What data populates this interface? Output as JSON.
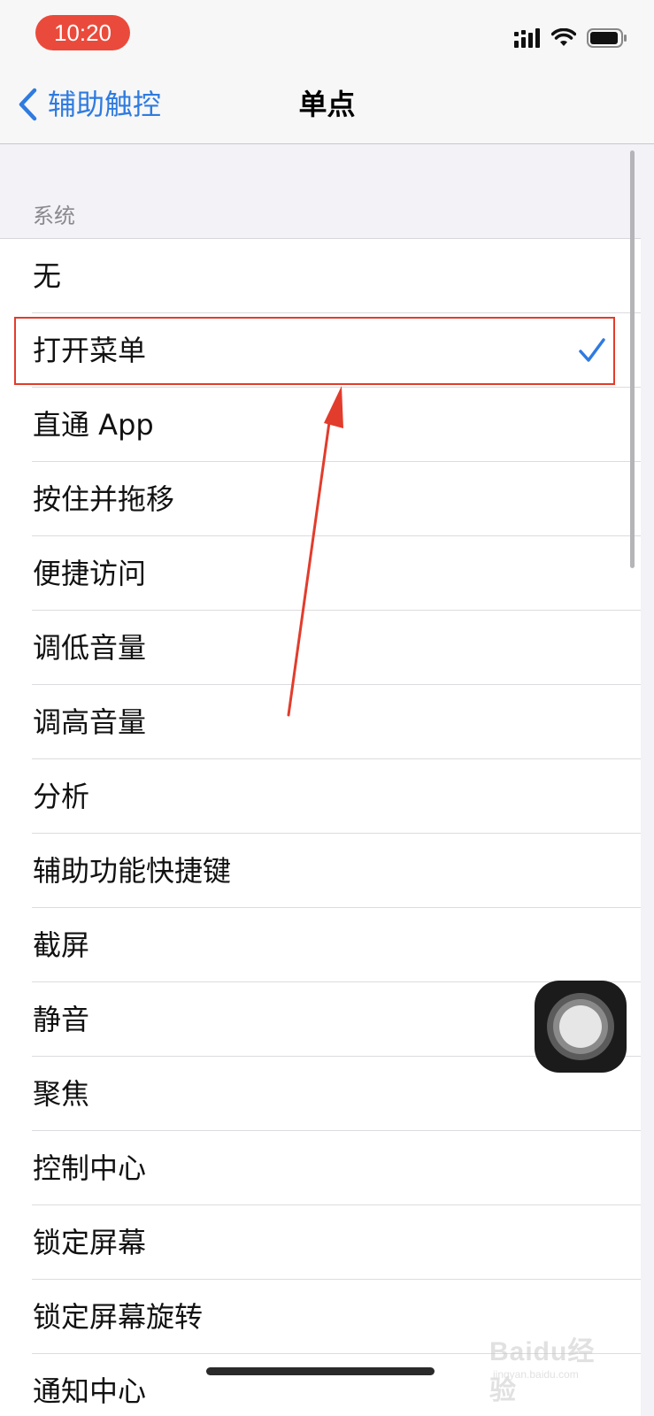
{
  "status_bar": {
    "time": "10:20",
    "icons": [
      "cellular-signal-icon",
      "wifi-icon",
      "battery-icon"
    ],
    "time_pill_color": "#ea4a3b"
  },
  "nav": {
    "back_label": "辅助触控",
    "title": "单点",
    "accent_color": "#2f7be0"
  },
  "section": {
    "header": "系统"
  },
  "list": {
    "selected_index": 1,
    "items": [
      {
        "label": "无"
      },
      {
        "label": "打开菜单"
      },
      {
        "label": "直通 App"
      },
      {
        "label": "按住并拖移"
      },
      {
        "label": "便捷访问"
      },
      {
        "label": "调低音量"
      },
      {
        "label": "调高音量"
      },
      {
        "label": "分析"
      },
      {
        "label": "辅助功能快捷键"
      },
      {
        "label": "截屏"
      },
      {
        "label": "静音"
      },
      {
        "label": "聚焦"
      },
      {
        "label": "控制中心"
      },
      {
        "label": "锁定屏幕"
      },
      {
        "label": "锁定屏幕旋转"
      },
      {
        "label": "通知中心"
      }
    ]
  },
  "annotation": {
    "color": "#e23c2c"
  },
  "watermark": {
    "text": "Baidu经验",
    "sub": "jingyan.baidu.com"
  }
}
